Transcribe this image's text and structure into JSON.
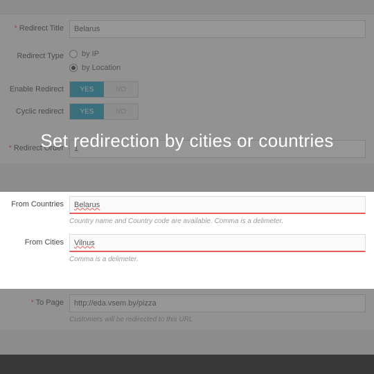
{
  "banner": "Set redirection by cities or countries",
  "form": {
    "redirect_title_label": "Redirect Title",
    "redirect_title_value": "Belarus",
    "redirect_type_label": "Redirect Type",
    "redirect_type_by_ip": "by IP",
    "redirect_type_by_location": "by Location",
    "enable_redirect_label": "Enable Redirect",
    "cyclic_redirect_label": "Cyclic redirect",
    "toggle_yes": "YES",
    "toggle_no": "NO",
    "redirect_order_label": "Redirect Order",
    "redirect_order_value": "1",
    "from_countries_label": "From Countries",
    "from_countries_value": "Belarus",
    "from_countries_hint": "Country name and Country code are available. Comma is a delimeter.",
    "from_cities_label": "From Cities",
    "from_cities_value": "Vilnus",
    "from_cities_hint": "Comma is a delimeter.",
    "to_page_label": "To Page",
    "to_page_value": "http://eda.vsem.by/pizza",
    "to_page_hint": "Customers will be redirected to this URL"
  }
}
